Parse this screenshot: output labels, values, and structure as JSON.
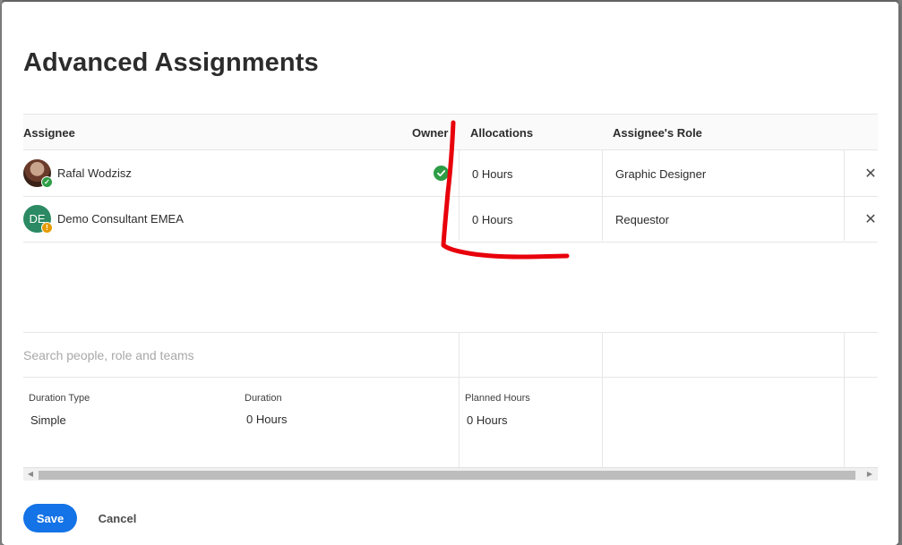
{
  "dialog": {
    "title": "Advanced Assignments"
  },
  "table": {
    "headers": {
      "assignee": "Assignee",
      "owner": "Owner",
      "allocations": "Allocations",
      "role": "Assignee's Role"
    },
    "rows": [
      {
        "name": "Rafal Wodzisz",
        "avatar": "photo",
        "status_badge": "check-icon",
        "is_owner": true,
        "allocation": "0 Hours",
        "role": "Graphic Designer",
        "remove_icon": "close-icon"
      },
      {
        "name": "Demo Consultant EMEA",
        "initials": "DE",
        "avatar_color": "#2b8a63",
        "status_badge": "warning-icon",
        "is_owner": false,
        "allocation": "0 Hours",
        "role": "Requestor",
        "remove_icon": "close-icon"
      }
    ]
  },
  "search": {
    "placeholder": "Search people, role and teams"
  },
  "details": {
    "duration_type_label": "Duration Type",
    "duration_type_value": "Simple",
    "duration_label": "Duration",
    "duration_value": "0 Hours",
    "planned_hours_label": "Planned Hours",
    "planned_hours_value": "0 Hours"
  },
  "footer": {
    "save_label": "Save",
    "cancel_label": "Cancel"
  },
  "colors": {
    "primary": "#1473e6",
    "success": "#2d9d46",
    "warning": "#e69b00",
    "annotation": "#e8000b"
  },
  "annotation": {
    "shape": "red-hand-drawn-L-stroke"
  }
}
